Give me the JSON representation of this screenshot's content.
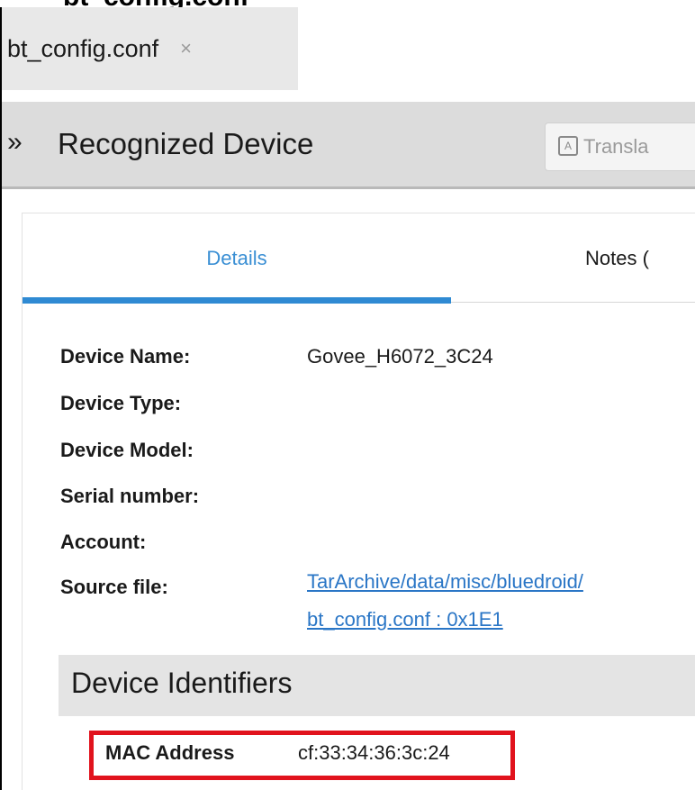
{
  "tab_bar": {
    "file_tab": {
      "label": "bt_config.conf",
      "close_glyph": "×",
      "close_icon": "close-icon"
    }
  },
  "header": {
    "chevron": "»",
    "title": "Recognized Device",
    "translate_label": "Transla",
    "translate_icon": "translate-icon"
  },
  "tabs": [
    {
      "label": "Details",
      "active": true,
      "accent": "#2f8ad3"
    },
    {
      "label": "Notes (",
      "active": false
    }
  ],
  "details": {
    "device_name": {
      "label": "Device Name:",
      "value": "Govee_H6072_3C24"
    },
    "device_type": {
      "label": "Device Type:",
      "value": ""
    },
    "device_model": {
      "label": "Device Model:",
      "value": ""
    },
    "serial_number": {
      "label": "Serial number:",
      "value": ""
    },
    "account": {
      "label": "Account:",
      "value": ""
    },
    "source_file": {
      "label": "Source file:",
      "value_line1": "TarArchive/data/misc/bluedroid/",
      "value_line2": "bt_config.conf : 0x1E1",
      "link_color": "#2a76c6"
    }
  },
  "identifiers": {
    "title": "Device Identifiers",
    "mac": {
      "label": "MAC Address",
      "value": "cf:33:34:36:3c:24",
      "highlight_color": "#e1131d"
    }
  }
}
